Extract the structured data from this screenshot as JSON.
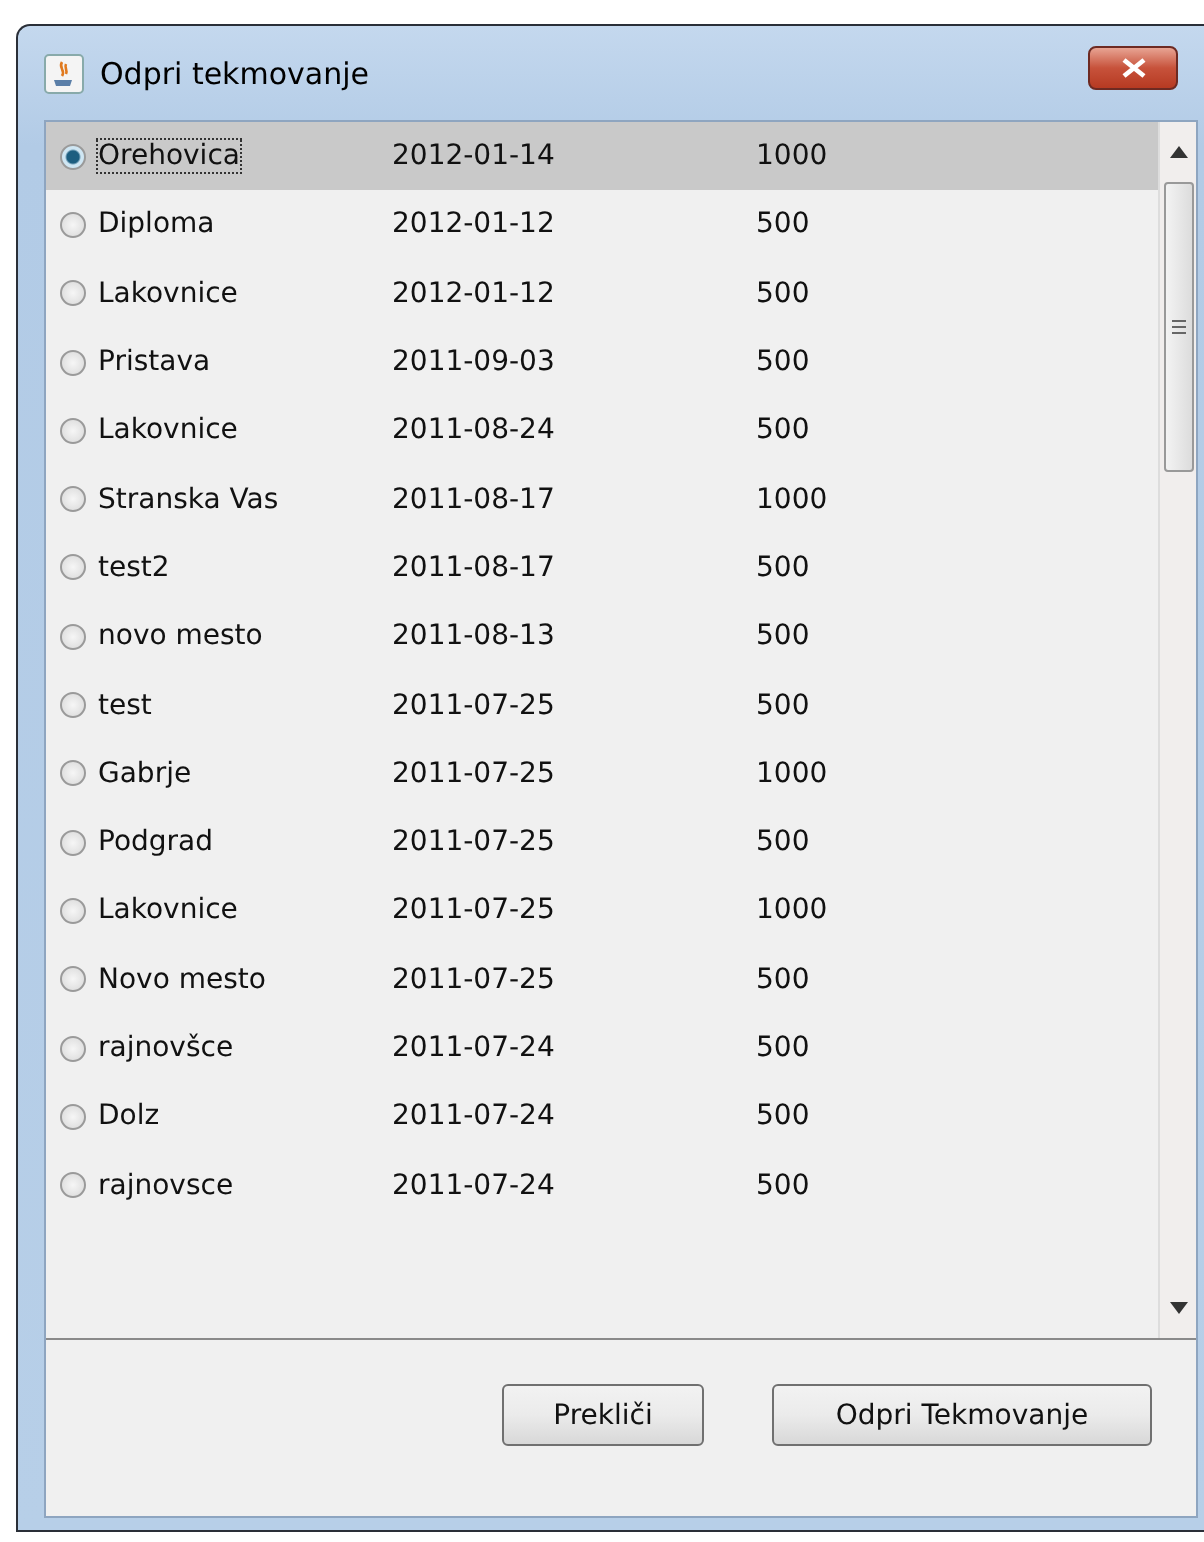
{
  "window": {
    "title": "Odpri tekmovanje"
  },
  "rows": [
    {
      "name": "Orehovica",
      "date": "2012-01-14",
      "value": "1000",
      "selected": true
    },
    {
      "name": "Diploma",
      "date": "2012-01-12",
      "value": "500",
      "selected": false
    },
    {
      "name": "Lakovnice",
      "date": "2012-01-12",
      "value": "500",
      "selected": false
    },
    {
      "name": "Pristava",
      "date": "2011-09-03",
      "value": "500",
      "selected": false
    },
    {
      "name": "Lakovnice",
      "date": "2011-08-24",
      "value": "500",
      "selected": false
    },
    {
      "name": "Stranska Vas",
      "date": "2011-08-17",
      "value": "1000",
      "selected": false
    },
    {
      "name": "test2",
      "date": "2011-08-17",
      "value": "500",
      "selected": false
    },
    {
      "name": "novo mesto",
      "date": "2011-08-13",
      "value": "500",
      "selected": false
    },
    {
      "name": "test",
      "date": "2011-07-25",
      "value": "500",
      "selected": false
    },
    {
      "name": "Gabrje",
      "date": "2011-07-25",
      "value": "1000",
      "selected": false
    },
    {
      "name": "Podgrad",
      "date": "2011-07-25",
      "value": "500",
      "selected": false
    },
    {
      "name": "Lakovnice",
      "date": "2011-07-25",
      "value": "1000",
      "selected": false
    },
    {
      "name": "Novo mesto",
      "date": "2011-07-25",
      "value": "500",
      "selected": false
    },
    {
      "name": "rajnovšce",
      "date": "2011-07-24",
      "value": "500",
      "selected": false
    },
    {
      "name": "Dolz",
      "date": "2011-07-24",
      "value": "500",
      "selected": false
    },
    {
      "name": "rajnovsce",
      "date": "2011-07-24",
      "value": "500",
      "selected": false
    }
  ],
  "buttons": [
    "Prekliči",
    "Odpri Tekmovanje"
  ]
}
